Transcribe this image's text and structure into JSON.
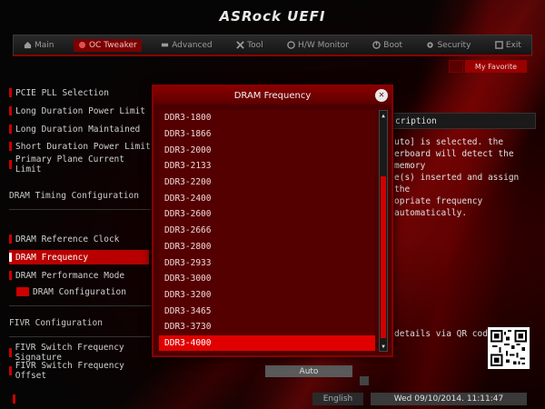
{
  "brand": "ASRock UEFI",
  "menu": [
    {
      "label": "Main",
      "icon": "home-icon",
      "active": false
    },
    {
      "label": "OC Tweaker",
      "icon": "rocket-icon",
      "active": true
    },
    {
      "label": "Advanced",
      "icon": "advanced-icon",
      "active": false
    },
    {
      "label": "Tool",
      "icon": "tool-icon",
      "active": false
    },
    {
      "label": "H/W Monitor",
      "icon": "monitor-icon",
      "active": false
    },
    {
      "label": "Boot",
      "icon": "power-icon",
      "active": false
    },
    {
      "label": "Security",
      "icon": "gear-icon",
      "active": false
    },
    {
      "label": "Exit",
      "icon": "exit-icon",
      "active": false
    }
  ],
  "favorite": "My Favorite",
  "left_items": [
    "PCIE PLL Selection",
    "Long Duration Power Limit",
    "Long Duration Maintained",
    "Short Duration Power Limit",
    "Primary Plane Current Limit",
    "DRAM Timing Configuration",
    "DRAM Reference Clock",
    "DRAM Frequency",
    "DRAM Performance Mode",
    "DRAM Configuration",
    "FIVR Configuration",
    "FIVR Switch Frequency Signature",
    "FIVR Switch Frequency Offset"
  ],
  "description": {
    "title": "cription",
    "lines": [
      "uto] is selected. the",
      "erboard will detect the memory",
      "e(s) inserted and assign the",
      "opriate frequency automatically."
    ]
  },
  "qr_text": "details via QR code",
  "auto_value": "Auto",
  "footer": {
    "language": "English",
    "datetime": "Wed 09/10/2014. 11:11:47"
  },
  "dialog": {
    "title": "DRAM Frequency",
    "close": "✕",
    "options": [
      "DDR3-1800",
      "DDR3-1866",
      "DDR3-2000",
      "DDR3-2133",
      "DDR3-2200",
      "DDR3-2400",
      "DDR3-2600",
      "DDR3-2666",
      "DDR3-2800",
      "DDR3-2933",
      "DDR3-3000",
      "DDR3-3200",
      "DDR3-3465",
      "DDR3-3730",
      "DDR3-4000"
    ],
    "selected_option": "DDR3-4000"
  },
  "colors": {
    "accent": "#c00000",
    "selected": "#e00000",
    "dialog_bg": "#550000"
  }
}
